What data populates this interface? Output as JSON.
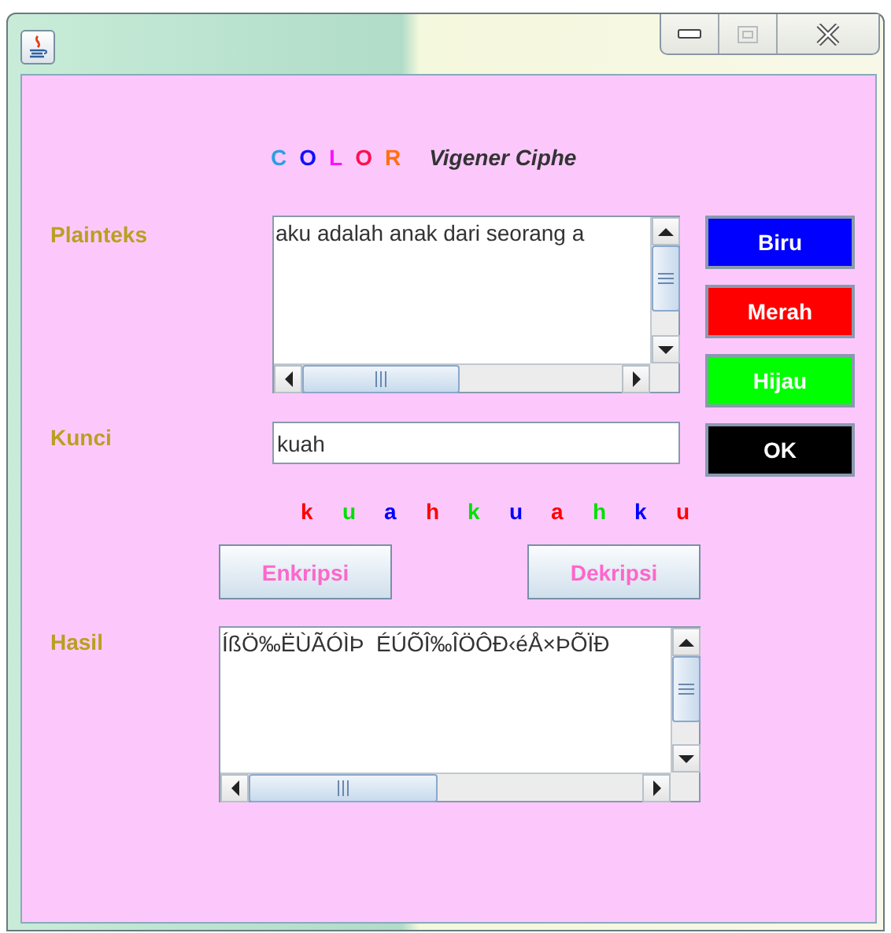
{
  "title": {
    "letters": [
      {
        "char": "C",
        "color": "#2aa0e0"
      },
      {
        "char": "O",
        "color": "#1010ff"
      },
      {
        "char": "L",
        "color": "#ff10ff"
      },
      {
        "char": "O",
        "color": "#ff1050"
      },
      {
        "char": "R",
        "color": "#ff7010"
      }
    ],
    "subtitle": "Vigener Ciphe"
  },
  "plaintext": {
    "label": "Plainteks",
    "value": "aku adalah anak dari seorang a"
  },
  "color_buttons": [
    {
      "label": "Biru",
      "color": "#0000ff"
    },
    {
      "label": "Merah",
      "color": "#ff0000"
    },
    {
      "label": "Hijau",
      "color": "#00ff00"
    },
    {
      "label": "OK",
      "color": "#000000"
    }
  ],
  "key": {
    "label": "Kunci",
    "value": "kuah"
  },
  "key_letters": [
    {
      "char": "k",
      "color": "#ff0000"
    },
    {
      "char": "u",
      "color": "#00e000"
    },
    {
      "char": "a",
      "color": "#0000ff"
    },
    {
      "char": "h",
      "color": "#ff0000"
    },
    {
      "char": "k",
      "color": "#00e000"
    },
    {
      "char": "u",
      "color": "#0000ff"
    },
    {
      "char": "a",
      "color": "#ff0000"
    },
    {
      "char": "h",
      "color": "#00e000"
    },
    {
      "char": "k",
      "color": "#0000ff"
    },
    {
      "char": "u",
      "color": "#ff0000"
    }
  ],
  "actions": [
    "Enkripsi",
    "Dekripsi"
  ],
  "result": {
    "label": "Hasil",
    "value": "ÍßÖ‰ËÙÃÓÌÞ  ÉÚÕÎ‰ÎÖÔÐ‹éÅ×ÞÕÏÐ"
  }
}
